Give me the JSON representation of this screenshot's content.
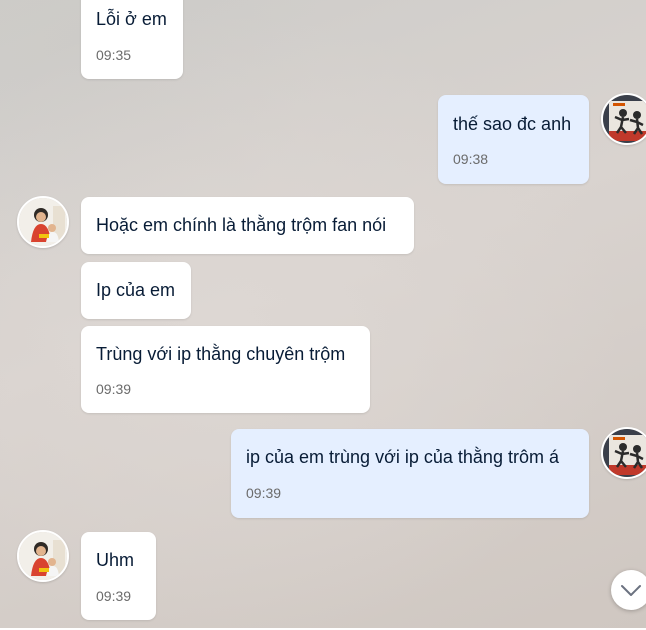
{
  "messages": [
    {
      "text": "Lỗi ở em",
      "time": "09:35",
      "sender": "them"
    },
    {
      "text": "thế sao đc anh",
      "time": "09:38",
      "sender": "me"
    },
    {
      "text": "Hoặc em chính là thằng trộm fan nói",
      "time": "",
      "sender": "them"
    },
    {
      "text": "Ip của em",
      "time": "",
      "sender": "them"
    },
    {
      "text": "Trùng với ip thằng chuyên trộm",
      "time": "09:39",
      "sender": "them"
    },
    {
      "text": "ip của em trùng với ip của thằng trôm á",
      "time": "09:39",
      "sender": "me"
    },
    {
      "text": "Uhm",
      "time": "09:39",
      "sender": "them"
    }
  ],
  "colors": {
    "my_bubble": "#e5efff",
    "their_bubble": "#ffffff",
    "message_text": "#081c36",
    "time_text": "#6b6b6b"
  },
  "icons": {
    "scroll_down": "chevron-down-icon"
  }
}
